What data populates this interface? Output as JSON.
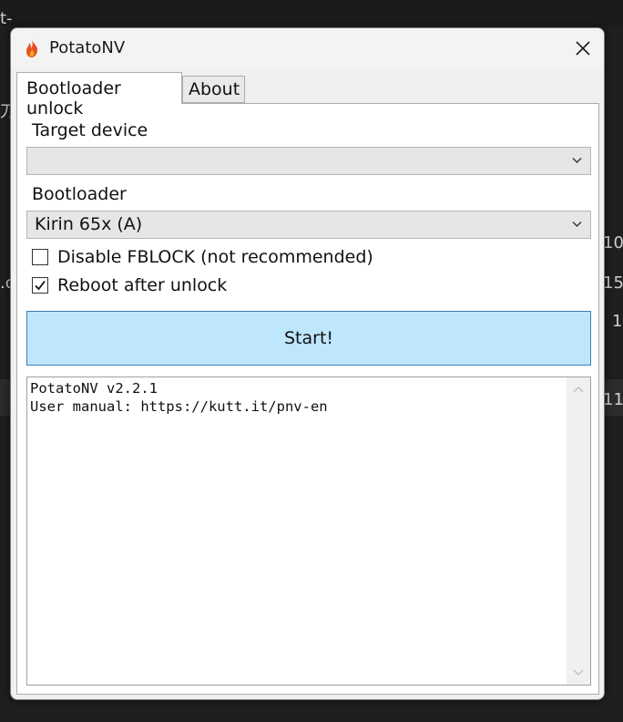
{
  "window": {
    "title": "PotatoNV",
    "close_icon": "close-icon",
    "app_icon": "flame-icon"
  },
  "tabs": [
    {
      "label": "Bootloader unlock",
      "active": true
    },
    {
      "label": "About",
      "active": false
    }
  ],
  "form": {
    "target_device_label": "Target device",
    "target_device_value": "",
    "bootloader_label": "Bootloader",
    "bootloader_value": "Kirin 65x (A)",
    "disable_fblock_label": "Disable FBLOCK (not recommended)",
    "disable_fblock_checked": false,
    "reboot_label": "Reboot after unlock",
    "reboot_checked": true,
    "start_label": "Start!"
  },
  "log": {
    "lines": [
      "PotatoNV v2.2.1",
      "User manual: https://kutt.it/pnv-en"
    ]
  },
  "colors": {
    "accent_button_bg": "#bee6fd",
    "accent_button_border": "#3c7fb1",
    "flame": "#e8501f"
  }
}
